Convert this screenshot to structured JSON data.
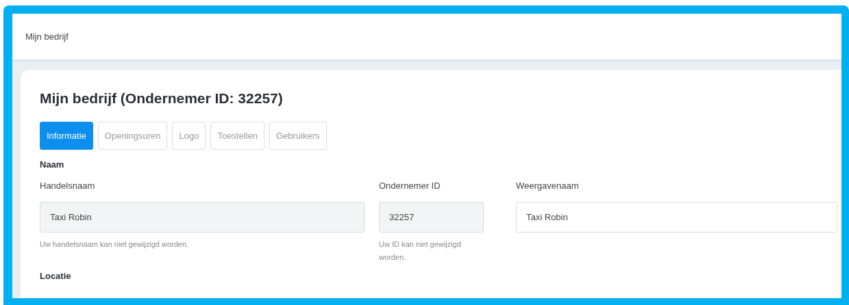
{
  "header": {
    "title": "Mijn bedrijf"
  },
  "page": {
    "title": "Mijn bedrijf (Ondernemer ID: 32257)"
  },
  "tabs": [
    {
      "label": "Informatie",
      "selected": true
    },
    {
      "label": "Openingsuren",
      "selected": false
    },
    {
      "label": "Logo",
      "selected": false
    },
    {
      "label": "Toestellen",
      "selected": false
    },
    {
      "label": "Gebruikers",
      "selected": false
    }
  ],
  "sections": [
    {
      "title": "Naam",
      "fields": [
        {
          "label": "Handelsnaam",
          "value": "Taxi Robin",
          "disabled": true,
          "help": "Uw handelsnaam kan niet gewijzigd worden."
        },
        {
          "label": "Ondernemer ID",
          "value": "32257",
          "disabled": true,
          "help": "Uw ID kan niet gewijzigd worden."
        },
        {
          "label": "Weergavenaam",
          "value": "Taxi Robin",
          "disabled": false
        }
      ]
    },
    {
      "title": "Locatie"
    }
  ]
}
